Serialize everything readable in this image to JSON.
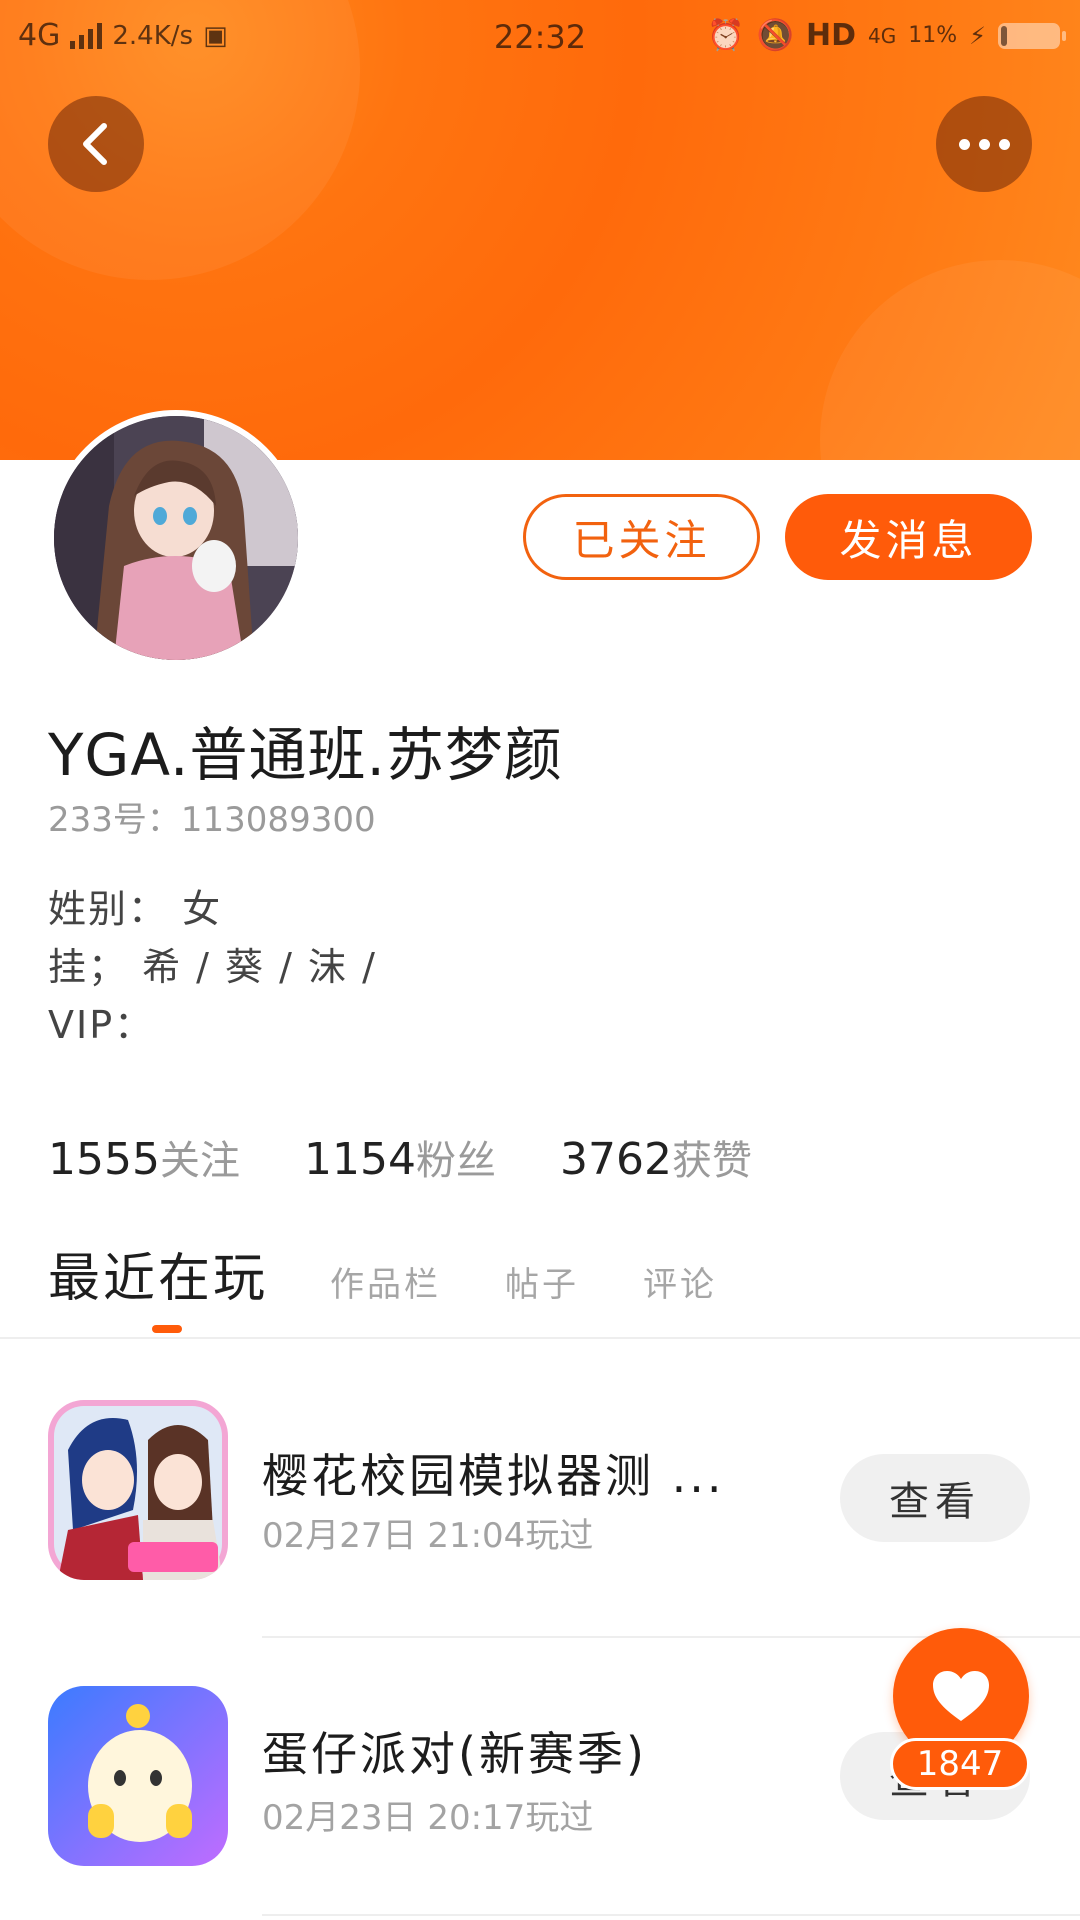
{
  "status_bar": {
    "network": "4G",
    "speed": "2.4K/s",
    "time": "22:32",
    "hd": "HD",
    "network_right": "4G",
    "battery": "11%"
  },
  "header": {
    "back_icon": "chevron-left-icon",
    "more_icon": "more-horizontal-icon",
    "accent_color": "#ff6a0b"
  },
  "profile": {
    "followed_label": "已关注",
    "message_label": "发消息",
    "username": "YGA.普通班.苏梦颜",
    "uid_label": "233号：",
    "uid_value": "113089300",
    "gender_line": "姓别： 女",
    "hang_line": "挂； 希 / 葵 / 沫 /",
    "vip_line": "VIP："
  },
  "stats": [
    {
      "num": "1555",
      "label": "关注"
    },
    {
      "num": "1154",
      "label": "粉丝"
    },
    {
      "num": "3762",
      "label": "获赞"
    }
  ],
  "tabs": [
    {
      "label": "最近在玩",
      "active": true
    },
    {
      "label": "作品栏",
      "active": false
    },
    {
      "label": "帖子",
      "active": false
    },
    {
      "label": "评论",
      "active": false
    }
  ],
  "games": [
    {
      "title": "樱花校园模拟器测 ...",
      "time": "02月27日 21:04玩过",
      "button": "查看"
    },
    {
      "title": "蛋仔派对(新赛季)",
      "time": "02月23日 20:17玩过",
      "button": "查看"
    }
  ],
  "like": {
    "icon": "heart-icon",
    "count": "1847"
  }
}
